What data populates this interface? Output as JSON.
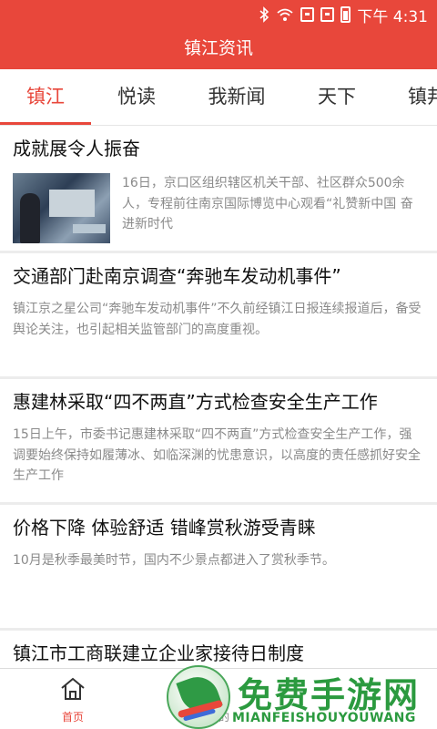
{
  "status_bar": {
    "time": "下午 4:31",
    "icons": [
      "bluetooth-icon",
      "wifi-icon",
      "sim-card-icon",
      "sim-card-icon",
      "battery-icon"
    ]
  },
  "header": {
    "title": "镇江资讯"
  },
  "tabs": [
    {
      "label": "镇江",
      "active": true
    },
    {
      "label": "悦读",
      "active": false
    },
    {
      "label": "我新闻",
      "active": false
    },
    {
      "label": "天下",
      "active": false
    },
    {
      "label": "镇邦",
      "active": false
    }
  ],
  "articles": [
    {
      "title": "成就展令人振奋",
      "summary": "16日，京口区组织辖区机关干部、社区群众500余人，专程前往南京国际博览中心观看“礼赞新中国 奋进新时代",
      "has_thumbnail": true
    },
    {
      "title": "交通部门赴南京调查“奔驰车发动机事件”",
      "summary": "镇江京之星公司“奔驰车发动机事件”不久前经镇江日报连续报道后，备受舆论关注，也引起相关监管部门的高度重视。"
    },
    {
      "title": "惠建林采取“四不两直”方式检查安全生产工作",
      "summary": "15日上午，市委书记惠建林采取“四不两直”方式检查安全生产工作，强调要始终保持如履薄冰、如临深渊的忧患意识，以高度的责任感抓好安全生产工作"
    },
    {
      "title": "价格下降 体验舒适 错峰赏秋游受青睐",
      "summary": "10月是秋季最美时节，国内不少景点都进入了赏秋季节。"
    },
    {
      "title": "镇江市工商联建立企业家接待日制度",
      "summary": ""
    }
  ],
  "bottom_nav": [
    {
      "label": "首页",
      "icon": "home-icon",
      "active": true
    },
    {
      "label": "我的",
      "icon": "user-icon",
      "active": false
    }
  ],
  "watermark": {
    "text": "免费手游网",
    "subtext": "MIANFEISHOUYOUWANG"
  },
  "colors": {
    "accent": "#e8473b",
    "watermark_green": "#2b9a3f"
  }
}
